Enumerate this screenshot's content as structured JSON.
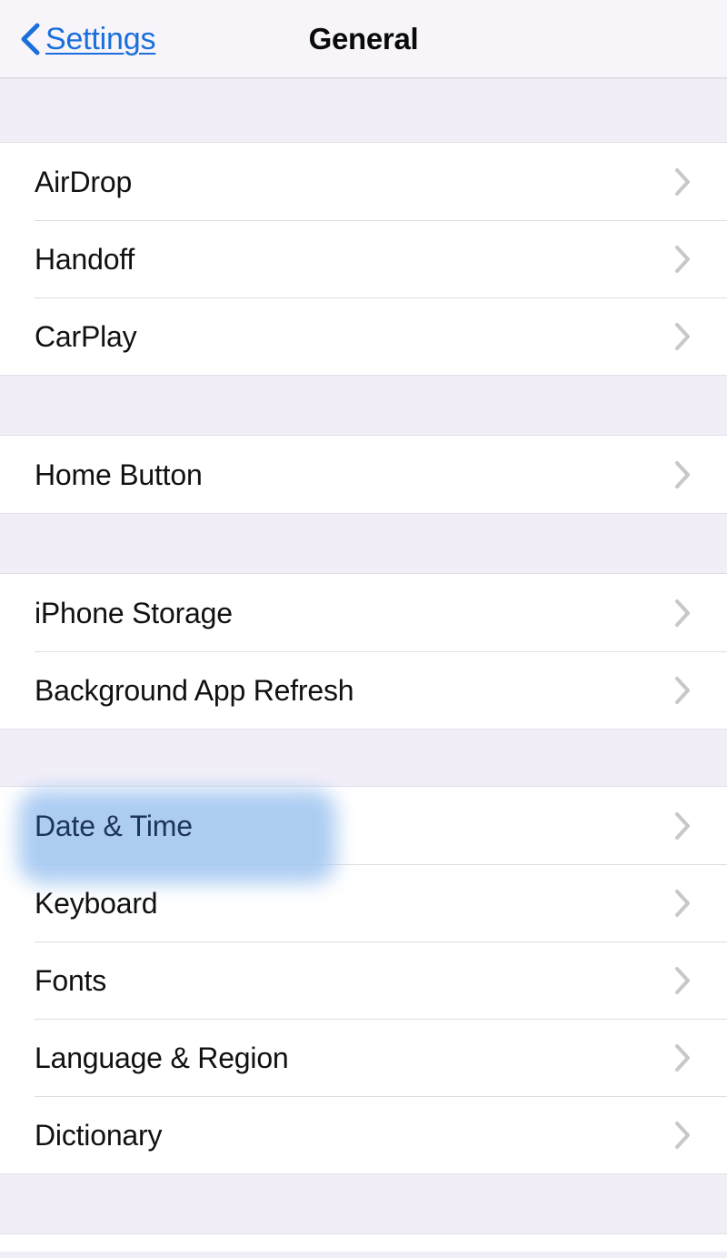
{
  "navbar": {
    "back_label": "Settings",
    "back_icon": "chevron-left-icon",
    "title": "General",
    "accent_color": "#1a6fdb"
  },
  "colors": {
    "group_background": "#f2eef8",
    "row_background": "#ffffff",
    "separator": "#dedee2",
    "chevron": "#c7c7cc",
    "highlight": "#a8caf2",
    "label": "#111111"
  },
  "sections": [
    {
      "id": "connectivity",
      "rows": [
        {
          "label": "AirDrop",
          "accessory": "chevron-right-icon",
          "highlighted": false
        },
        {
          "label": "Handoff",
          "accessory": "chevron-right-icon",
          "highlighted": false
        },
        {
          "label": "CarPlay",
          "accessory": "chevron-right-icon",
          "highlighted": false
        }
      ]
    },
    {
      "id": "home-button",
      "rows": [
        {
          "label": "Home Button",
          "accessory": "chevron-right-icon",
          "highlighted": false
        }
      ]
    },
    {
      "id": "storage",
      "rows": [
        {
          "label": "iPhone Storage",
          "accessory": "chevron-right-icon",
          "highlighted": false
        },
        {
          "label": "Background App Refresh",
          "accessory": "chevron-right-icon",
          "highlighted": false
        }
      ]
    },
    {
      "id": "localization",
      "rows": [
        {
          "label": "Date & Time",
          "accessory": "chevron-right-icon",
          "highlighted": true
        },
        {
          "label": "Keyboard",
          "accessory": "chevron-right-icon",
          "highlighted": false
        },
        {
          "label": "Fonts",
          "accessory": "chevron-right-icon",
          "highlighted": false
        },
        {
          "label": "Language & Region",
          "accessory": "chevron-right-icon",
          "highlighted": false
        },
        {
          "label": "Dictionary",
          "accessory": "chevron-right-icon",
          "highlighted": false
        }
      ]
    }
  ]
}
